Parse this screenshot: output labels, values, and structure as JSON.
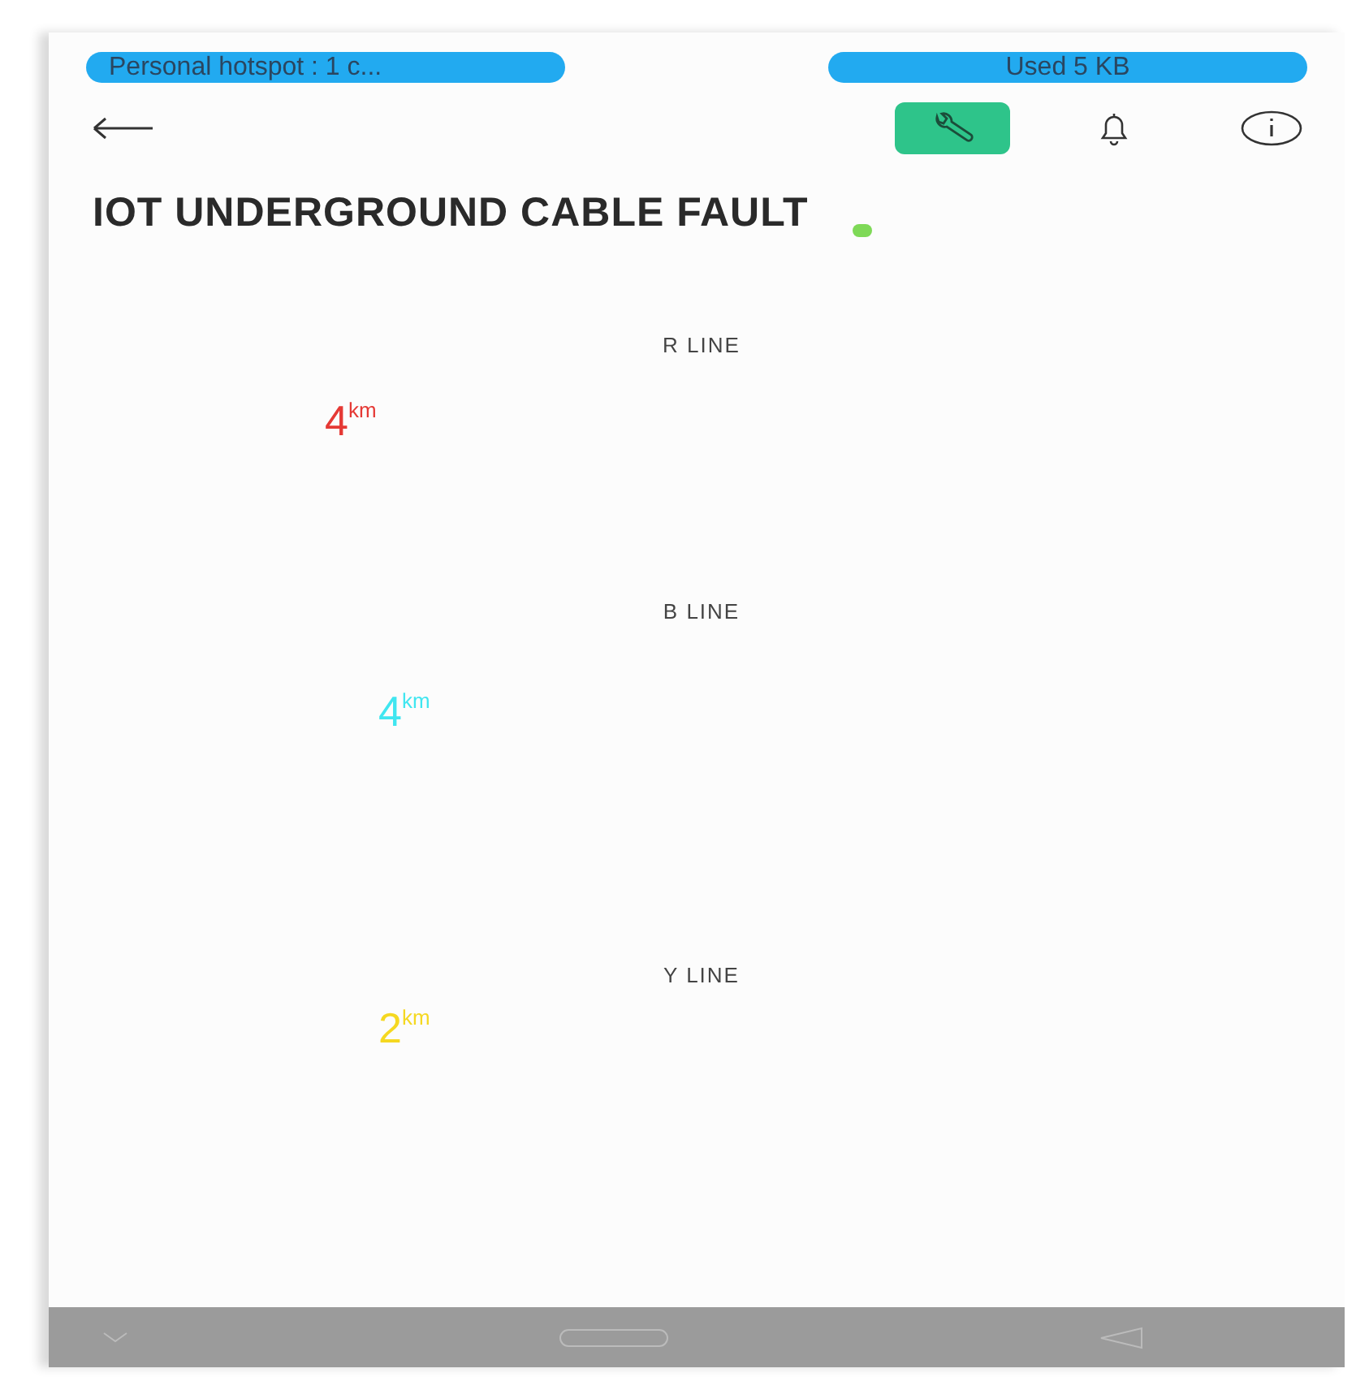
{
  "status_bar": {
    "hotspot": "Personal hotspot : 1 c...",
    "data_usage": "Used  5 KB"
  },
  "toolbar": {
    "tool_selected": true
  },
  "title": "IOT UNDERGROUND CABLE FAULT",
  "online": true,
  "lines": [
    {
      "label": "R LINE",
      "value": "4",
      "unit": "km",
      "color": "#e53935"
    },
    {
      "label": "B LINE",
      "value": "4",
      "unit": "km",
      "color": "#40e6f0"
    },
    {
      "label": "Y LINE",
      "value": "2",
      "unit": "km",
      "color": "#f5d821"
    }
  ]
}
